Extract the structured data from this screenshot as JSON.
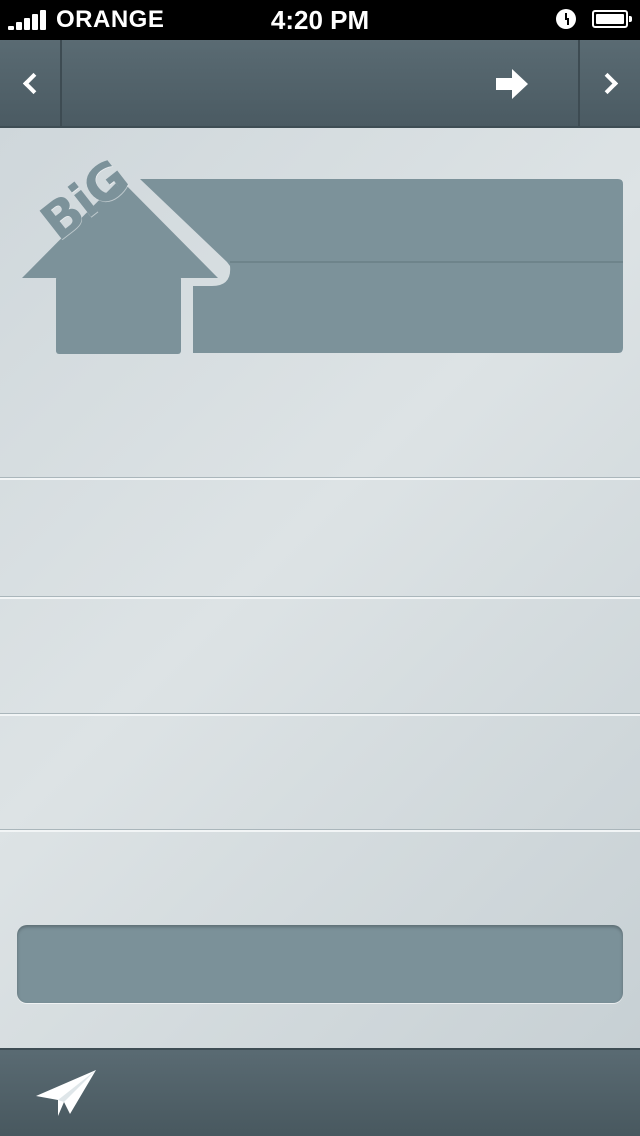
{
  "status_bar": {
    "carrier": "ORANGE",
    "time": "4:20 PM",
    "signal_bars": 5
  },
  "nav": {
    "back_icon": "chevron-left-icon",
    "forward_arrow_icon": "arrow-right-icon",
    "next_icon": "chevron-right-icon"
  },
  "logo": {
    "text": "BiG"
  },
  "toolbar": {
    "send_icon": "paper-plane-icon"
  },
  "colors": {
    "nav_background": "#52626a",
    "content_background": "#d6dcdf",
    "field_fill": "#7b9199",
    "accent_white": "#ffffff"
  }
}
